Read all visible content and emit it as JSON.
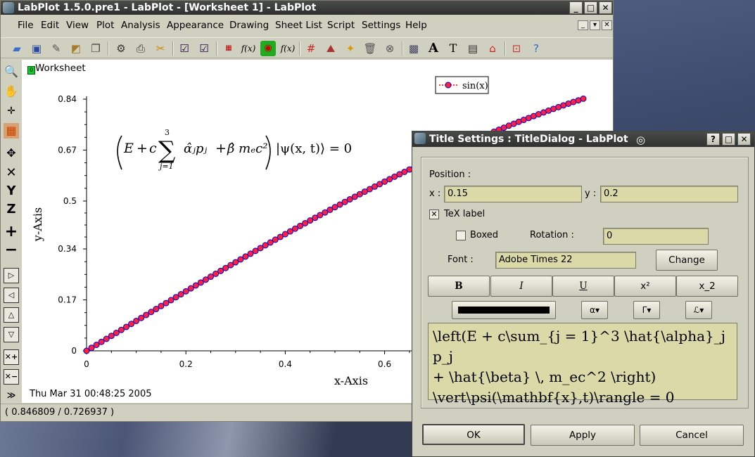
{
  "main_window": {
    "title": "LabPlot 1.5.0.pre1 - LabPlot - [Worksheet 1] - LabPlot",
    "controls": [
      "_",
      "□",
      "✕"
    ]
  },
  "menubar": {
    "items": [
      "File",
      "Edit",
      "View",
      "Plot",
      "Analysis",
      "Appearance",
      "Drawing",
      "Sheet List",
      "Script",
      "Settings",
      "Help"
    ],
    "mdi_controls": [
      "_",
      "▾",
      "✕"
    ]
  },
  "toolbar": {
    "icons": [
      "open-folder-icon",
      "save-icon",
      "print-preview-icon",
      "export-icon",
      "copy-icon",
      "settings-icon",
      "printer-icon",
      "cut-icon",
      "plot-2d-icon",
      "plot-2d-alt-icon",
      "data-icon",
      "function-icon",
      "surface-icon",
      "function-3d-icon",
      "grid-icon",
      "rocket-icon",
      "shape-icon",
      "trash-icon",
      "close-icon",
      "image-icon",
      "text-bold-icon",
      "text-icon",
      "note-icon",
      "building-icon",
      "rect-icon",
      "help-icon"
    ],
    "labels": {
      "fx": "f(x)",
      "fxy": "f(x)",
      "bigA": "A",
      "bigT": "T"
    }
  },
  "worksheet": {
    "label": "Worksheet",
    "label_badge": "0",
    "timestamp": "Thu Mar 31 00:48:25 2005",
    "formula": {
      "lhs_E": "E",
      "plus1": "+",
      "c": "c",
      "sum_top": "3",
      "sum_bottom": "j=1",
      "alpha_term": "α̂ⱼpⱼ",
      "plus2": "+",
      "beta_term": "β̂ mₑc²",
      "rhs": "|ψ(x, t)⟩ = 0"
    }
  },
  "chart_data": {
    "type": "line",
    "xlabel": "x-Axis",
    "ylabel": "y-Axis",
    "xlim": [
      0,
      1.0
    ],
    "ylim": [
      0,
      0.84
    ],
    "x_ticks": [
      "0",
      "0.2",
      "0.4",
      "0.6"
    ],
    "y_ticks": [
      "0",
      "0.17",
      "0.34",
      "0.5",
      "0.67",
      "0.84"
    ],
    "y_tick_values": [
      0,
      0.17,
      0.34,
      0.5,
      0.67,
      0.84
    ],
    "x_tick_values": [
      0,
      0.2,
      0.4,
      0.6
    ],
    "series": [
      {
        "name": "sin(x)",
        "function": "sin(x)",
        "x_start": 0,
        "x_end": 1.0,
        "n_points": 101,
        "line_color": "#ff0000",
        "marker_fill": "#ff2040",
        "marker_edge": "#0000cc"
      }
    ],
    "legend_position": "top-right",
    "grid": false
  },
  "statusbar": {
    "coords": "( 0.846809 / 0.726937 )"
  },
  "dialog": {
    "title": "Title Settings : TitleDialog - LabPlot",
    "controls": [
      "?",
      "□",
      "✕"
    ],
    "position_label": "Position :",
    "x_label": "x :",
    "x_value": "0.15",
    "y_label": "y :",
    "y_value": "0.2",
    "tex_label": "TeX label",
    "tex_checked": "✕",
    "boxed_label": "Boxed",
    "rotation_label": "Rotation :",
    "rotation_value": "0",
    "font_label": "Font :",
    "font_value": "Adobe Times 22",
    "change_button": "Change",
    "format_buttons": {
      "bold": "B",
      "italic": "I",
      "underline": "U",
      "superscript": "x²",
      "subscript": "x_2"
    },
    "symbol_buttons": {
      "greek_lower": "α▾",
      "greek_upper": "Γ▾",
      "misc": "ℒ▾"
    },
    "tex_text_lines": [
      "\\left(E + c\\sum_{j = 1}^3 \\hat{\\alpha}_j p_j",
      "+ \\hat{\\beta} \\, m_ec^2 \\right)",
      "\\vert\\psi(\\mathbf{x},t)\\rangle = 0"
    ],
    "ok_button": "OK",
    "apply_button": "Apply",
    "cancel_button": "Cancel"
  }
}
